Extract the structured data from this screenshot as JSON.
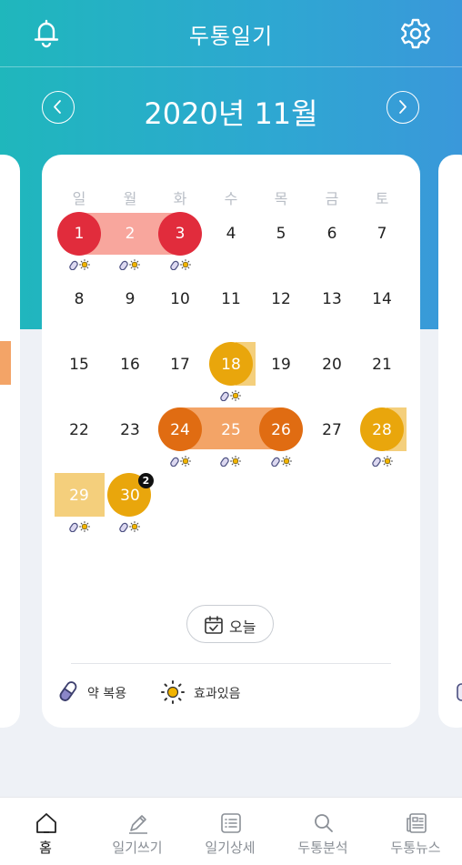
{
  "header": {
    "title": "두통일기"
  },
  "calendar": {
    "month_label": "2020년 11월",
    "weekdays": [
      "일",
      "월",
      "화",
      "수",
      "목",
      "금",
      "토"
    ],
    "days": [
      "1",
      "2",
      "3",
      "4",
      "5",
      "6",
      "7",
      "8",
      "9",
      "10",
      "11",
      "12",
      "13",
      "14",
      "15",
      "16",
      "17",
      "18",
      "19",
      "20",
      "21",
      "22",
      "23",
      "24",
      "25",
      "26",
      "27",
      "28",
      "29",
      "30"
    ],
    "badge_30": "2",
    "today_label": "오늘"
  },
  "legend": {
    "medication": "약 복용",
    "effective": "효과있음"
  },
  "tabs": [
    {
      "label": "홈"
    },
    {
      "label": "일기쓰기"
    },
    {
      "label": "일기상세"
    },
    {
      "label": "두통분석"
    },
    {
      "label": "두통뉴스"
    }
  ],
  "colors": {
    "severe": "#e12c3c",
    "severe_light": "#f8a69d",
    "moderate": "#e06c12",
    "moderate_light": "#f3a467",
    "mild": "#e9a60c",
    "mild_light": "#f4cf7c",
    "accent": "#2ea7d2"
  }
}
